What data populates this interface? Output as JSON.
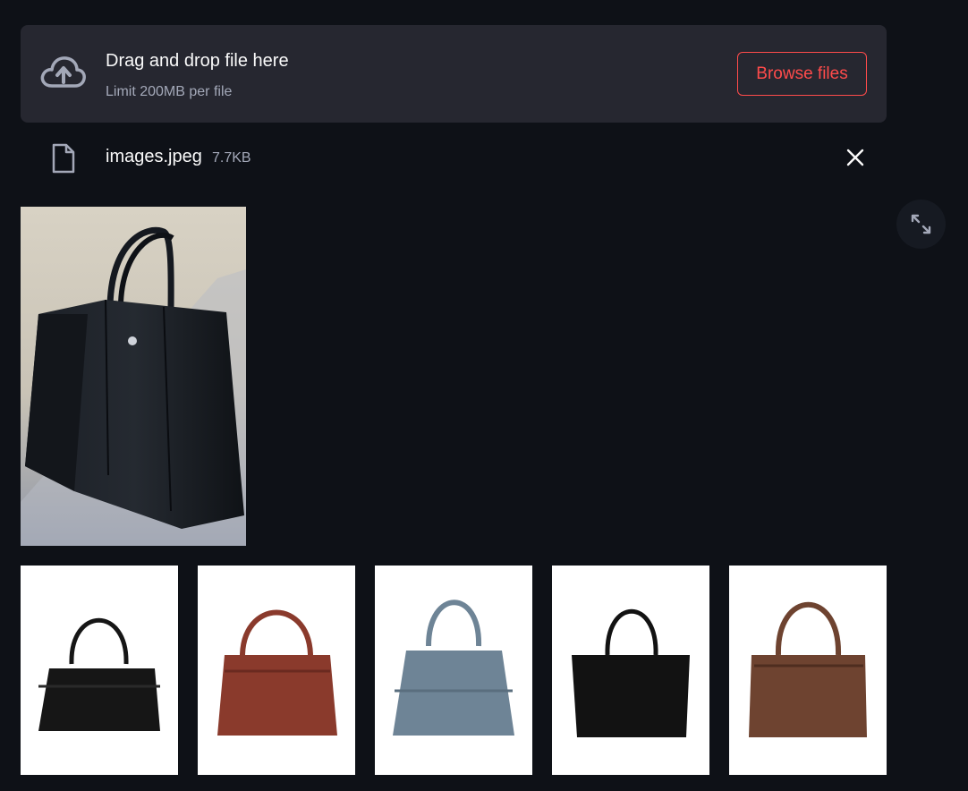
{
  "uploader": {
    "title": "Drag and drop file here",
    "limit": "Limit 200MB per file",
    "browse_label": "Browse files",
    "icon": "cloud-upload-icon"
  },
  "file": {
    "name": "images.jpeg",
    "size": "7.7KB",
    "icon": "file-icon",
    "remove_icon": "close-icon"
  },
  "main_image": {
    "subject": "black leather tote bag"
  },
  "expand_icon": "fullscreen-icon",
  "results": [
    {
      "color": "#161616"
    },
    {
      "color": "#8a3a2c"
    },
    {
      "color": "#6e8496"
    },
    {
      "color": "#121212"
    },
    {
      "color": "#6e4330"
    }
  ],
  "colors": {
    "background": "#0e1117",
    "dropzone": "#262730",
    "accent": "#ff4b4b",
    "muted_text": "#a3a8b8"
  }
}
